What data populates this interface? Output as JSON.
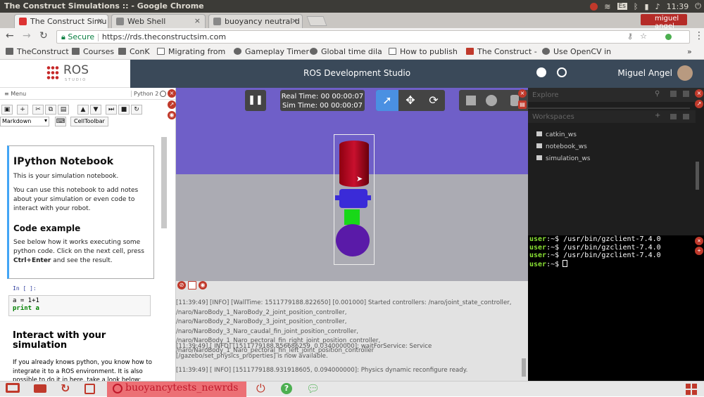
{
  "window_title": "The Construct Simulations :: - Google Chrome",
  "os_tray": {
    "lang": "Es",
    "time": "11:39",
    "user": "miguel angel"
  },
  "tabs": [
    {
      "label": "The Construct Simu",
      "active": true,
      "favicon_color": "#d33"
    },
    {
      "label": "Web Shell",
      "active": false,
      "favicon_color": "#888"
    },
    {
      "label": "buoyancy neutral d",
      "active": false,
      "favicon_color": "#888"
    }
  ],
  "address": {
    "secure_label": "Secure",
    "url": "https://rds.theconstructsim.com"
  },
  "bookmarks": [
    "TheConstruct",
    "Courses",
    "ConK",
    "Migrating from",
    "Gameplay Timer",
    "Global time dila",
    "How to publish",
    "The Construct -",
    "Use OpenCV in"
  ],
  "bookmarks_more": "»",
  "logo": {
    "text": "ROS",
    "sub": "STUDIO"
  },
  "header": {
    "title": "ROS Development Studio",
    "user": "Miguel Angel"
  },
  "notebook": {
    "menu_label": "Menu",
    "kernel": "Python 2",
    "cell_type": "Markdown",
    "celltoolbar_label": "CellToolbar",
    "card": {
      "title": "IPython Notebook",
      "intro": "This is your simulation notebook.",
      "desc": "You can use this notebook to add notes about your simulation or even code to interact with your robot.",
      "code_title": "Code example",
      "code_desc_a": "See below how it works executing some python code. Click on the next cell, press ",
      "code_desc_bold": "Ctrl+Enter",
      "code_desc_b": " and see the result."
    },
    "prompt": "In [ ]:",
    "code_line1": "a = 1+1",
    "code_line2": "print a",
    "interact_title": "Interact with your simulation",
    "interact_desc": "If you already knows python, you know how to integrate it to a ROS environment. It is also possible to do it in here, take a look below:"
  },
  "sim": {
    "real_time": "Real Time: 00 00:00:07",
    "sim_time": "Sim Time: 00 00:00:07"
  },
  "console_lines": [
    "[11:39:49] [INFO] [WallTime: 1511779188.822650] [0.001000] Started controllers: /naro/joint_state_controller, /naro/NaroBody_1_NaroBody_2_joint_position_controller, /naro/NaroBody_2_NaroBody_3_joint_position_controller, /naro/NaroBody_3_Naro_caudal_fin_joint_position_controller, /naro/NaroBody_1_Naro_pectoral_fin_right_joint_position_controller, /naro/NaroBody_1_Naro_pectoral_fin_left_joint_position_controller",
    "[11:39:49] [ INFO] [1511779188.856686259, 0.034000000]: waitForService: Service [/gazebo/set_physics_properties] is now available.",
    "[11:39:49] [ INFO] [1511779188.931918605, 0.094000000]: Physics dynamic reconfigure ready."
  ],
  "explore": {
    "label": "Explore",
    "workspaces_label": "Workspaces",
    "items": [
      "catkin_ws",
      "notebook_ws",
      "simulation_ws"
    ]
  },
  "terminal": {
    "user": "user",
    "path": ":~$",
    "cmd": " /usr/bin/gzclient-7.4.0"
  },
  "bottom": {
    "project": "buoyancytests_newrds"
  }
}
